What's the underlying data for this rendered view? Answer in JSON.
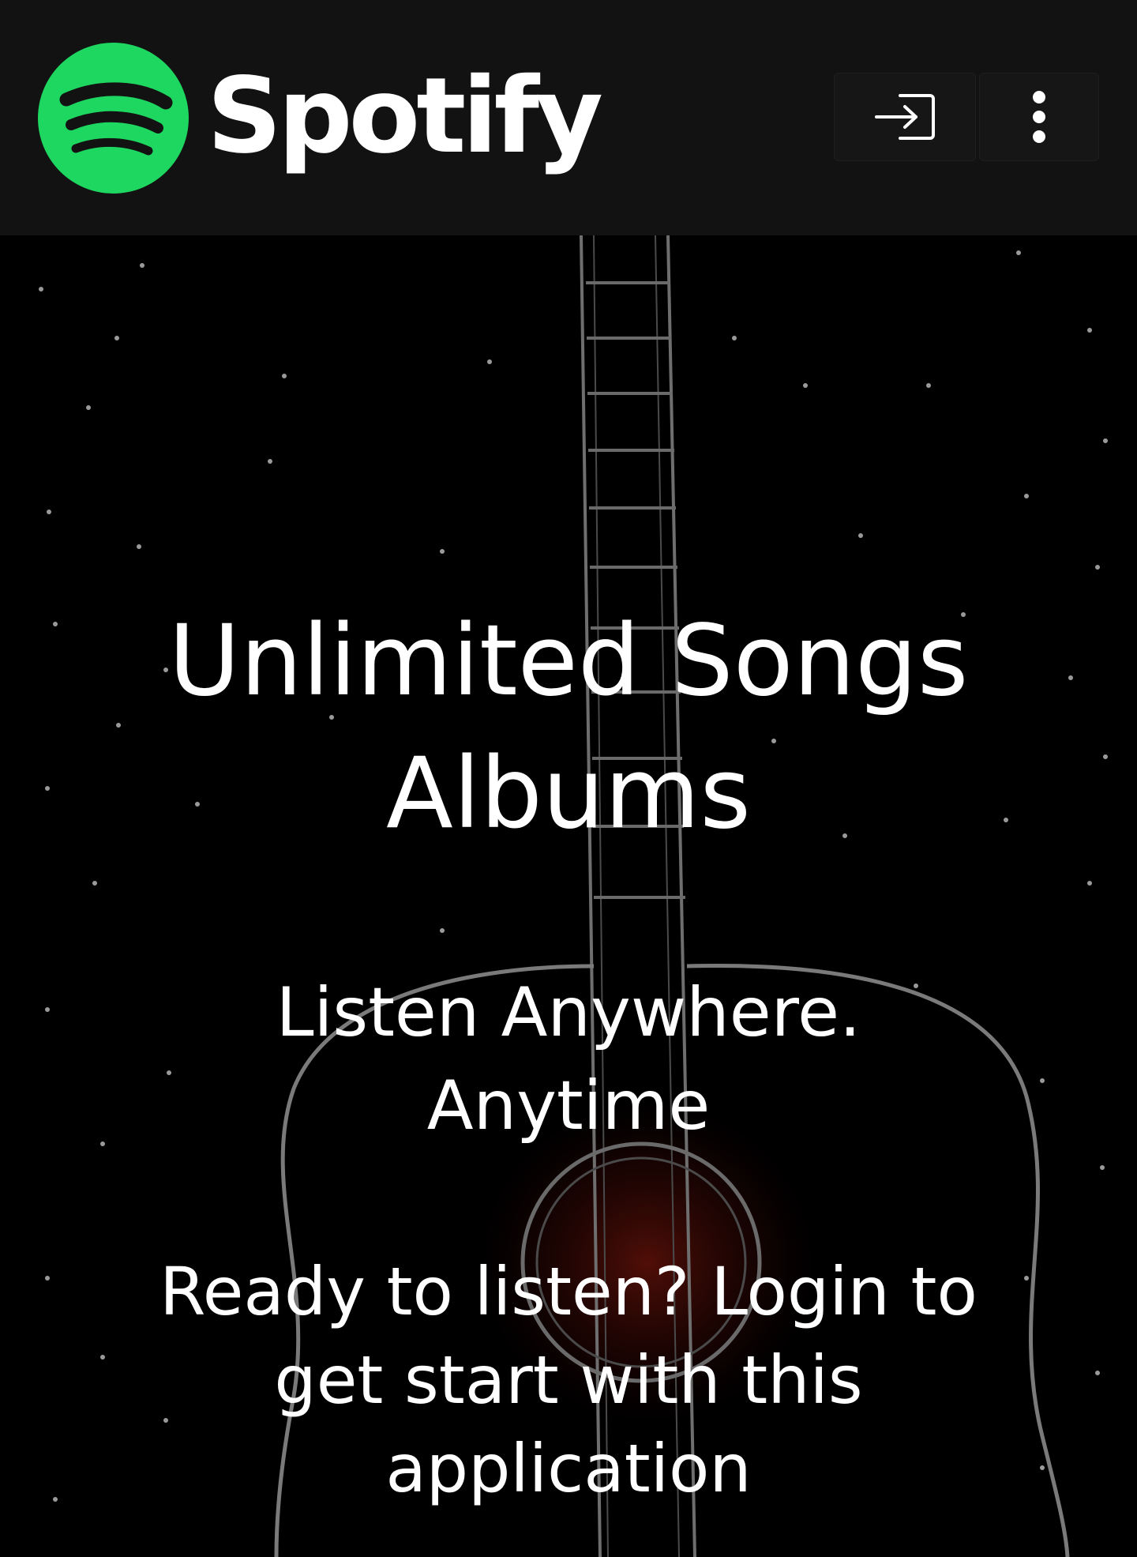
{
  "header": {
    "brand_name": "Spotify",
    "logo_icon": "spotify-logo-icon",
    "login_icon": "login-icon",
    "menu_icon": "more-vert-icon",
    "background_color": "#121212",
    "brand_color": "#1ED760"
  },
  "hero": {
    "headline_line1": "Unlimited Songs",
    "headline_line2": "Albums",
    "tagline_line1": "Listen Anywhere.",
    "tagline_line2": "Anytime",
    "cta_text": "Ready to listen? Login to get start with this application",
    "background_image": "guitar-silhouette-starfield"
  }
}
